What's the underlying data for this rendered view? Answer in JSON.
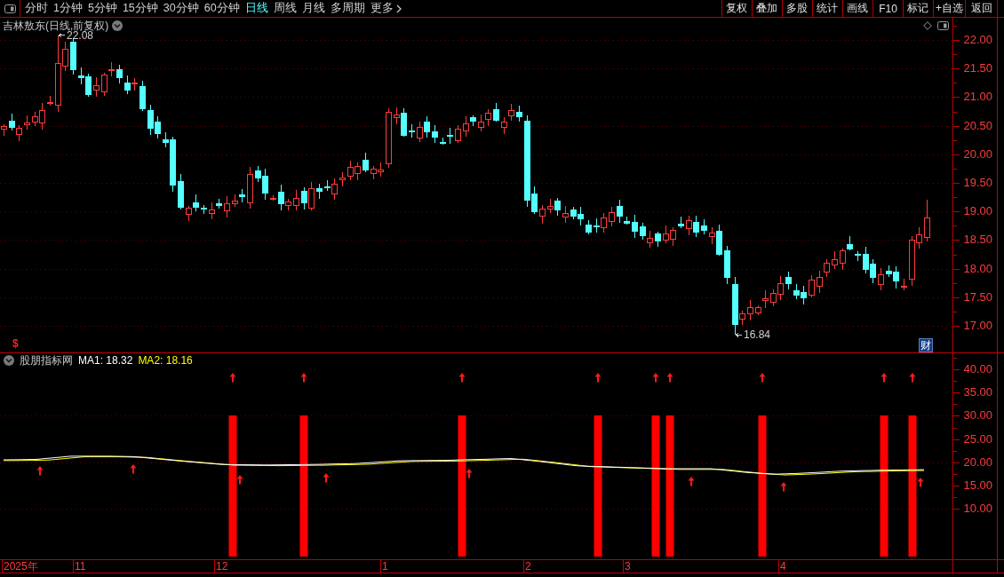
{
  "toolbar": {
    "periods": [
      {
        "label": "分时",
        "selected": false
      },
      {
        "label": "1分钟",
        "selected": false
      },
      {
        "label": "5分钟",
        "selected": false
      },
      {
        "label": "15分钟",
        "selected": false
      },
      {
        "label": "30分钟",
        "selected": false
      },
      {
        "label": "60分钟",
        "selected": false
      },
      {
        "label": "日线",
        "selected": true
      },
      {
        "label": "周线",
        "selected": false
      },
      {
        "label": "月线",
        "selected": false
      },
      {
        "label": "多周期",
        "selected": false
      }
    ],
    "more": "更多",
    "actions": [
      "复权",
      "叠加",
      "多股",
      "统计",
      "画线",
      "F10",
      "标记",
      "+自选",
      "返回"
    ]
  },
  "main_chart": {
    "title": "吉林敖东(日线,前复权)",
    "high_label": "22.08",
    "low_label": "16.84",
    "signal_marker": "$",
    "badge": "财",
    "price_axis": [
      "22.00",
      "21.50",
      "21.00",
      "20.50",
      "20.00",
      "19.50",
      "19.00",
      "18.50",
      "18.00",
      "17.50",
      "17.00"
    ]
  },
  "indicator": {
    "name": "股朋指标网",
    "legend": [
      {
        "text": "MA1: 18.32",
        "color": "#ffffff"
      },
      {
        "text": "MA2: 18.16",
        "color": "#ffff00"
      }
    ],
    "axis": [
      "40.00",
      "35.00",
      "30.00",
      "25.00",
      "20.00",
      "15.00",
      "10.00"
    ]
  },
  "date_axis": [
    "2025年",
    "11",
    "12",
    "1",
    "2",
    "3",
    "4"
  ]
}
